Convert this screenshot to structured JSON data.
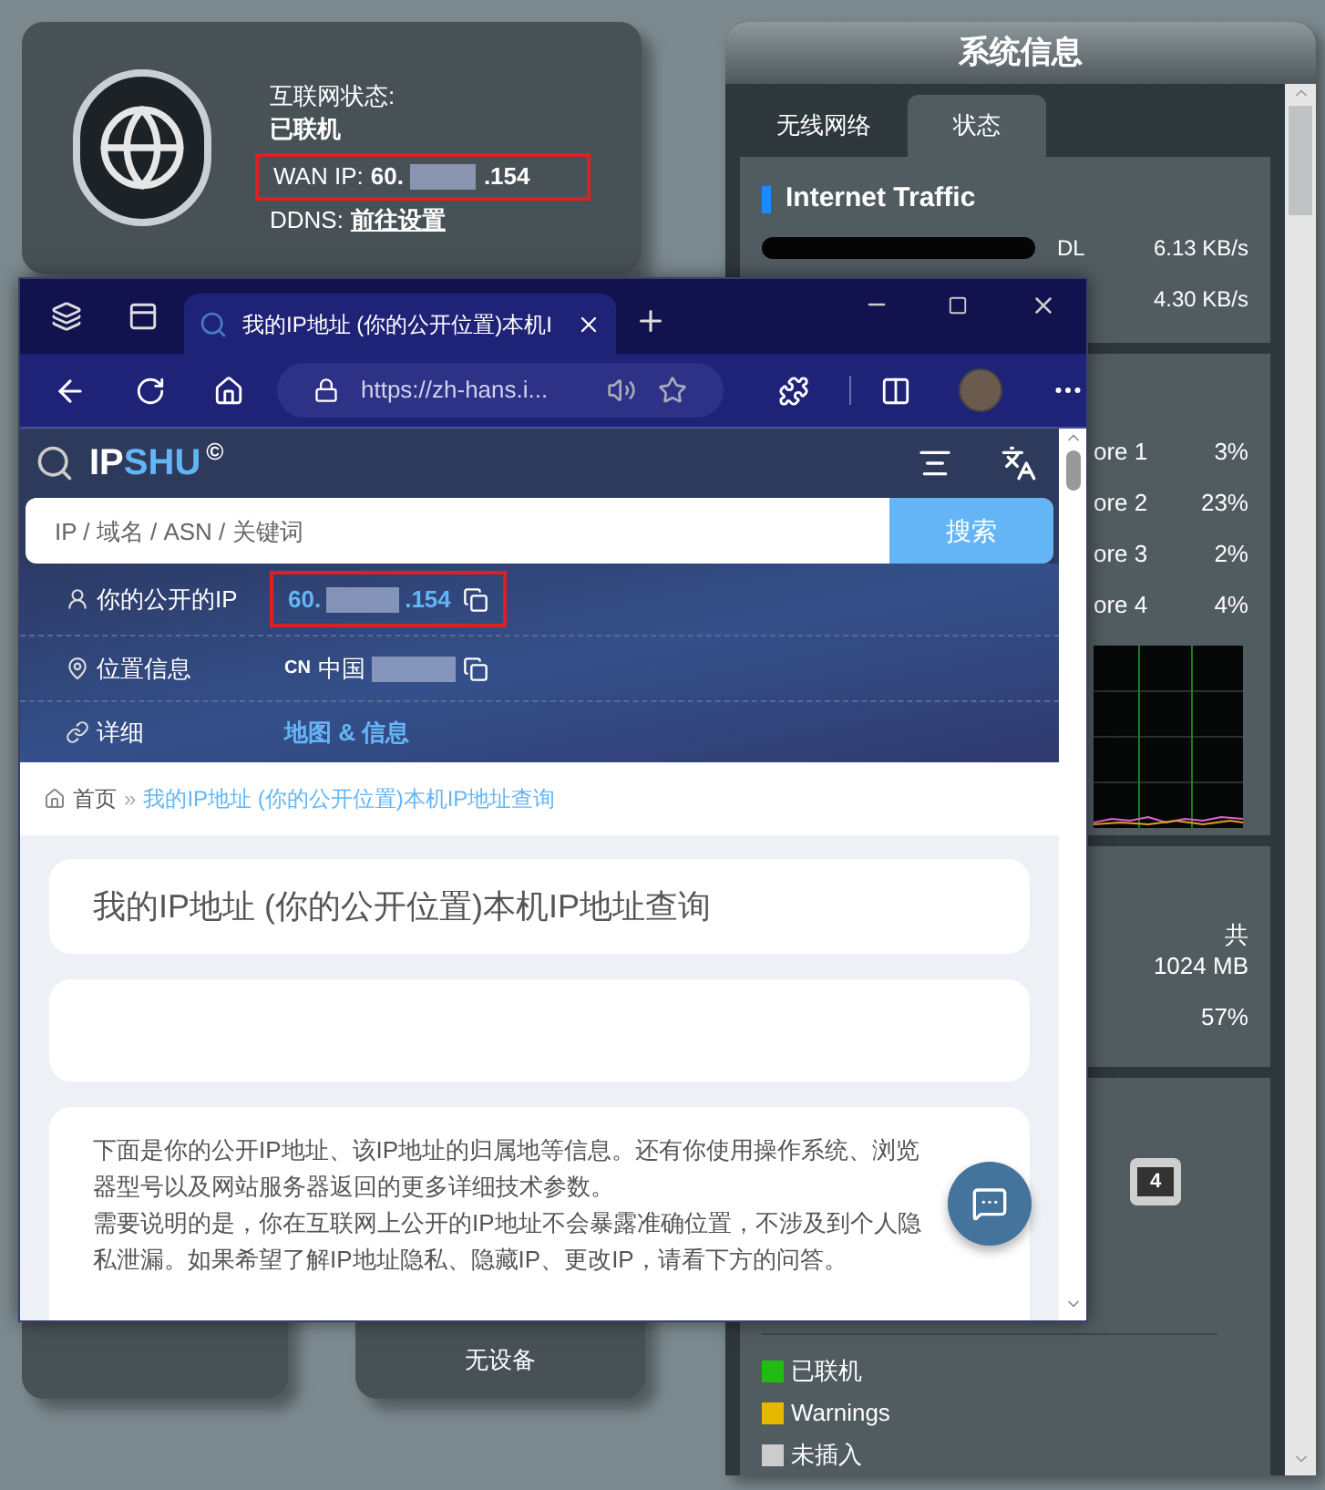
{
  "router": {
    "internet_status": {
      "label": "互联网状态:",
      "status": "已联机",
      "wan_ip_label": "WAN IP:",
      "wan_ip_prefix": "60.",
      "wan_ip_suffix": ".154",
      "highlighted": true,
      "ddns_label": "DDNS:",
      "ddns_link": "前往设置"
    },
    "usb_cards": [
      {
        "kind": "empty"
      },
      {
        "kind": "text",
        "label": "无设备"
      }
    ],
    "system_info": {
      "title": "系统信息",
      "tabs": [
        {
          "label": "无线网络",
          "selected": false
        },
        {
          "label": "状态",
          "selected": true
        }
      ],
      "traffic": {
        "title": "Internet Traffic",
        "rows": [
          {
            "label": "DL",
            "value": "6.13 KB/s"
          },
          {
            "value": "4.30 KB/s"
          }
        ]
      },
      "cpu": {
        "cores": [
          {
            "label": "ore 1",
            "value": "3%"
          },
          {
            "label": "ore 2",
            "value": "23%"
          },
          {
            "label": "ore 3",
            "value": "2%"
          },
          {
            "label": "ore 4",
            "value": "4%"
          }
        ]
      },
      "memory": {
        "total_label": "共",
        "total": "1024 MB",
        "usage": "57%"
      },
      "ports": [
        {
          "label": "4"
        }
      ],
      "legend": [
        {
          "label": "已联机",
          "color": "#22bb11"
        },
        {
          "label": "Warnings",
          "color": "#e6b800"
        },
        {
          "label": "未插入",
          "color": "#cccccc"
        }
      ]
    }
  },
  "browser": {
    "tab_title": "我的IP地址 (你的公开位置)本机I",
    "url": "https://zh-hans.i...",
    "site": {
      "logo_ip": "IP",
      "logo_shu": "SHU",
      "logo_mark": "©",
      "search_placeholder": "IP / 域名 / ASN / 关键词",
      "search_button": "搜索",
      "info_rows": [
        {
          "kind": "ip",
          "label": "你的公开的IP",
          "prefix": "60.",
          "suffix": ".154",
          "highlighted": true
        },
        {
          "kind": "location",
          "label": "位置信息",
          "country_code": "CN",
          "country": "中国"
        },
        {
          "kind": "link",
          "label": "详细",
          "value": "地图 & 信息"
        }
      ],
      "breadcrumb": {
        "home": "首页",
        "separator": "»",
        "current": "我的IP地址 (你的公开位置)本机IP地址查询"
      },
      "heading": "我的IP地址 (你的公开位置)本机IP地址查询",
      "paragraphs": [
        "下面是你的公开IP地址、该IP地址的归属地等信息。还有你使用操作系统、浏览器型号以及网站服务器返回的更多详细技术参数。",
        "需要说明的是，你在互联网上公开的IP地址不会暴露准确位置，不涉及到个人隐私泄漏。如果希望了解IP地址隐私、隐藏IP、更改IP，请看下方的问答。"
      ]
    }
  }
}
